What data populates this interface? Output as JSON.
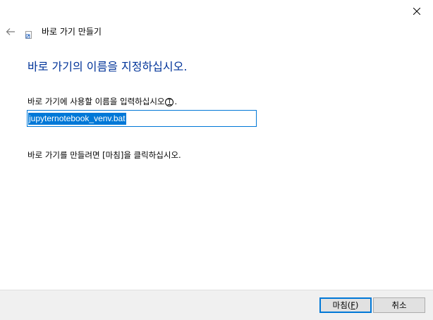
{
  "window": {
    "title": "바로 가기 만들기"
  },
  "page": {
    "heading": "바로 가기의 이름을 지정하십시오.",
    "name_label": "바로 가기에 사용할 이름을 입력하십시오",
    "name_label_mnemonic": "T",
    "name_label_suffix": ".",
    "name_value": "jupyternotebook_venv.bat",
    "instruction": "바로 가기를 만들려면 [마침]을 클릭하십시오."
  },
  "footer": {
    "finish_label": "마침(",
    "finish_mnemonic": "F",
    "finish_suffix": ")",
    "cancel_label": "취소"
  },
  "colors": {
    "heading": "#003399",
    "accent": "#0078d7",
    "footer_bg": "#f0f0f0"
  },
  "icons": {
    "close": "close-icon",
    "back": "back-arrow-icon",
    "shortcut": "shortcut-icon"
  }
}
